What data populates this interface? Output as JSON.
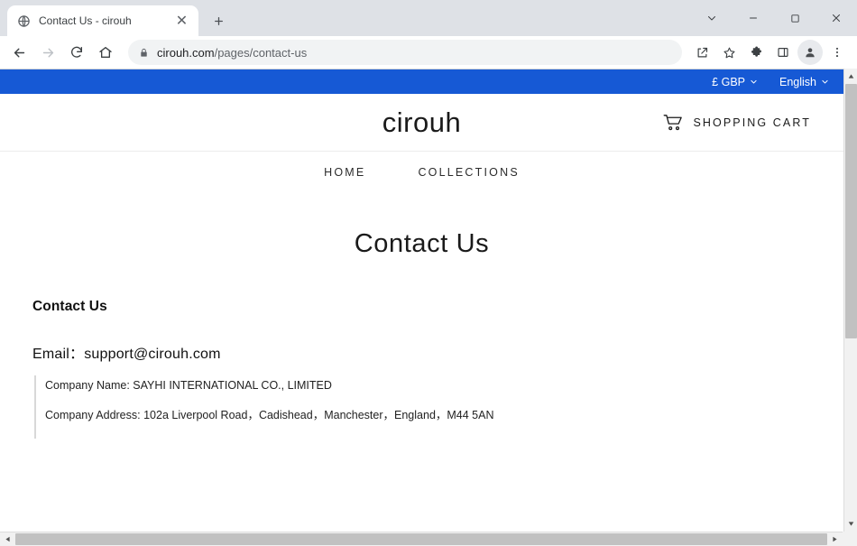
{
  "browser": {
    "tab": {
      "favicon": "globe-icon",
      "title": "Contact Us - cirouh",
      "close": "✕"
    },
    "newtab_label": "+",
    "window_controls": {
      "minimize_tabsearch": "⌄",
      "minimize": "—",
      "maximize": "□",
      "close": "✕"
    },
    "toolbar": {
      "back": "←",
      "forward": "→",
      "reload": "↻",
      "home": "⌂",
      "lock": "lock-icon",
      "url_host": "cirouh.com",
      "url_path": "/pages/contact-us",
      "share": "share-icon",
      "bookmark": "star-icon",
      "extensions": "puzzle-icon",
      "side_panel": "side-panel-icon",
      "profile": "avatar-icon",
      "menu": "⋮"
    }
  },
  "site": {
    "topbar": {
      "currency": "£ GBP",
      "currency_caret": "⌄",
      "language": "English",
      "language_caret": "⌄",
      "background": "#1659d5"
    },
    "header": {
      "logo": "cirouh",
      "cart_icon": "shopping-cart-icon",
      "cart_label": "SHOPPING CART"
    },
    "nav": [
      {
        "label": "HOME"
      },
      {
        "label": "COLLECTIONS"
      }
    ],
    "page": {
      "title": "Contact Us",
      "section_title": "Contact Us",
      "email_line": "Email：support@cirouh.com",
      "details": [
        "Company Name: SAYHI INTERNATIONAL CO., LIMITED",
        "Company Address: 102a Liverpool Road，Cadishead，Manchester，England，M44 5AN"
      ]
    }
  },
  "scrollbars": {
    "vertical_up": "▲",
    "vertical_down": "▼",
    "horizontal_left": "◀",
    "horizontal_right": "▶"
  }
}
